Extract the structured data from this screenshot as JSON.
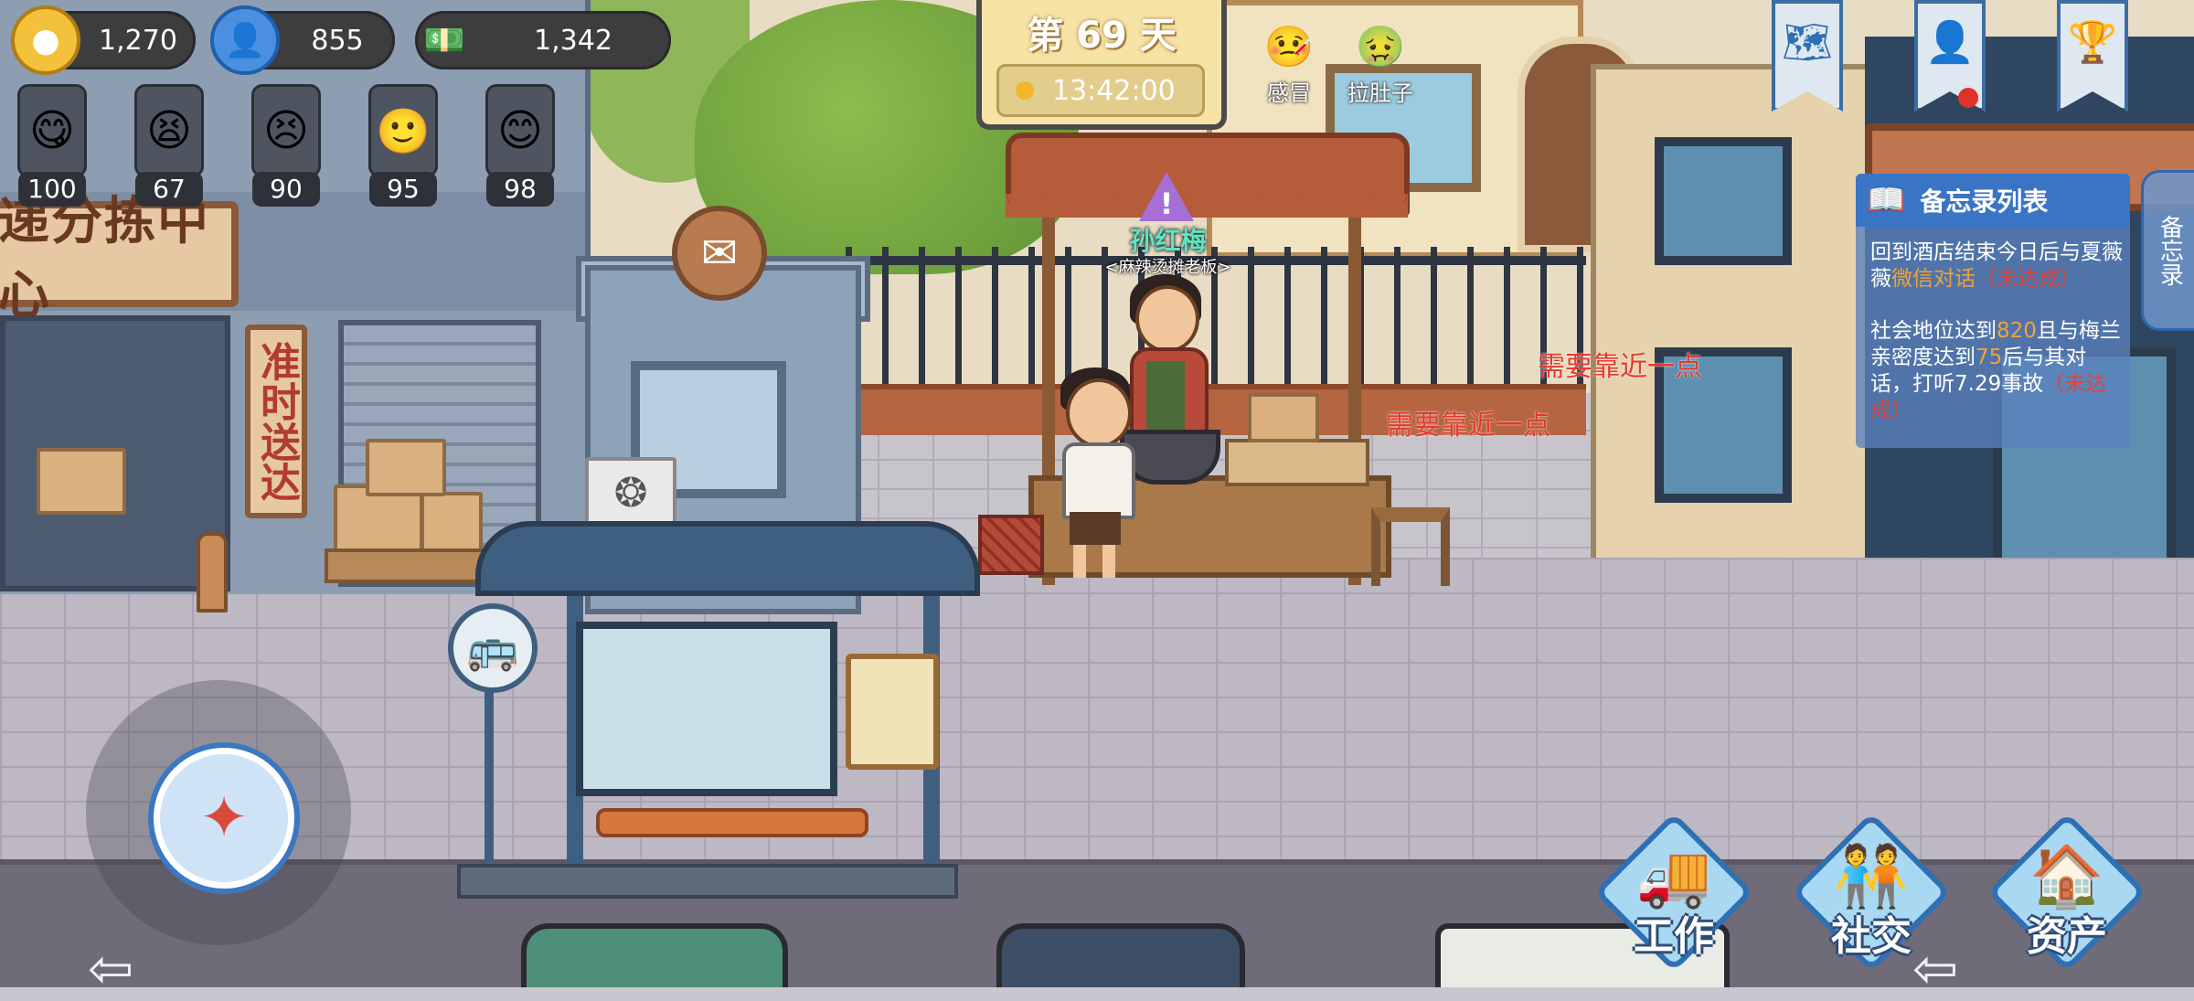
{
  "resources": {
    "gold": "1,270",
    "reputation": "855",
    "cash": "1,342"
  },
  "npc_affinity": [
    {
      "icon": "😋",
      "value": "100"
    },
    {
      "icon": "😫",
      "value": "67"
    },
    {
      "icon": "😣",
      "value": "90"
    },
    {
      "icon": "🙂",
      "value": "95"
    },
    {
      "icon": "😊",
      "value": "98"
    }
  ],
  "day": {
    "title": "第 69 天",
    "time": "13:42:00"
  },
  "status_effects": [
    {
      "icon": "🤒",
      "label": "感冒"
    },
    {
      "icon": "🤢",
      "label": "拉肚子"
    }
  ],
  "top_right_buttons": [
    {
      "name": "map",
      "icon": "🗺"
    },
    {
      "name": "character",
      "icon": "👤"
    },
    {
      "name": "ranking",
      "icon": "🏆"
    }
  ],
  "scene_signs": {
    "sorting_center": "递分拣中心",
    "on_time": "准时送达"
  },
  "npc": {
    "name": "孙红梅",
    "role": "<麻辣烫摊老板>"
  },
  "floating_messages": [
    "需要靠近一点",
    "需要靠近一点"
  ],
  "memo": {
    "title": "备忘录列表",
    "tab_label": "备忘录",
    "task1_a": "回到酒店结束今日后与夏薇薇",
    "task1_hl": "微信对话",
    "task1_status": "（未达成）",
    "task2_a": "社会地位达到",
    "task2_num1": "820",
    "task2_b": "且与梅兰亲密度达到",
    "task2_num2": "75",
    "task2_c": "后与其对话，打听7.29事故",
    "task2_status": "（未达成）"
  },
  "bottom_menu": [
    {
      "label": "工作",
      "icon": "🚚"
    },
    {
      "label": "社交",
      "icon": "🧑‍🤝‍🧑"
    },
    {
      "label": "资产",
      "icon": "🏠"
    }
  ],
  "colors": {
    "accent_blue": "#3b78c0",
    "highlight_orange": "#f0a23a",
    "warning_red": "#e33a2e",
    "npc_name_green": "#5fe3c3"
  }
}
